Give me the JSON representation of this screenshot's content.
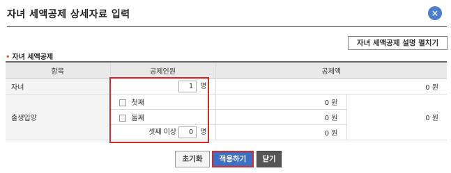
{
  "dialog": {
    "title": "자녀 세액공제 상세자료 입력",
    "close_glyph": "×",
    "explain_button": "자녀 세액공제 설명 펼치기"
  },
  "section": {
    "bullet": "•",
    "label": "자녀 세액공제"
  },
  "table": {
    "headers": [
      "항목",
      "공제인원",
      "공제액"
    ],
    "rows": {
      "children": {
        "label": "자녀",
        "count": "1",
        "unit": "명",
        "amount": "0 원"
      },
      "birth": {
        "label": "출생입양",
        "first_label": "첫째",
        "first_amount": "0 원",
        "second_label": "둘째",
        "second_amount": "0 원",
        "third_label": "셋째 이상",
        "third_count": "0",
        "third_unit": "명",
        "third_amount": "0 원",
        "total_amount": "0 원"
      }
    }
  },
  "buttons": {
    "reset": "초기화",
    "apply": "적용하기",
    "close": "닫기"
  },
  "colors": {
    "accent": "#3d70c2",
    "highlight": "#d42a2a",
    "close_circle": "#4a7fd0"
  }
}
